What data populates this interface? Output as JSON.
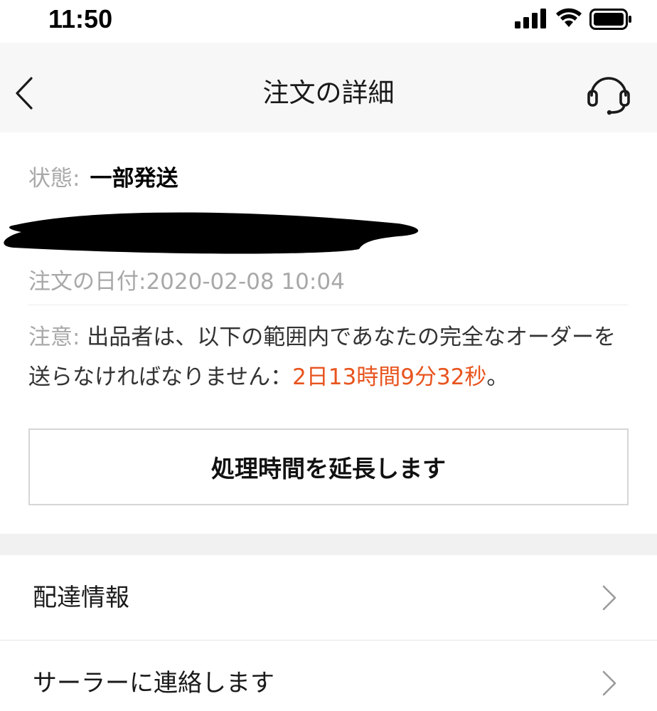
{
  "status_bar": {
    "time": "11:50"
  },
  "nav": {
    "title": "注文の詳細"
  },
  "order": {
    "status_label": "状態:",
    "status_value": "一部発送",
    "order_date": "注文の日付:2020-02-08 10:04",
    "notice_label": "注意:",
    "notice_text": " 出品者は、以下の範囲内であなたの完全なオーダーを送らなければなりません：",
    "countdown": "2日13時間9分32秒",
    "notice_end": "。",
    "extend_button_label": "処理時間を延長します"
  },
  "menu": {
    "items": [
      {
        "label": "配達情報"
      },
      {
        "label": "サーラーに連絡します"
      }
    ]
  },
  "icons": {
    "back": "chevron-left-icon",
    "support": "headset-icon",
    "chevron": "chevron-right-icon"
  },
  "colors": {
    "accent": "#e8541e",
    "muted_text": "#a8a8a8",
    "nav_bg": "#f7f7f7"
  }
}
